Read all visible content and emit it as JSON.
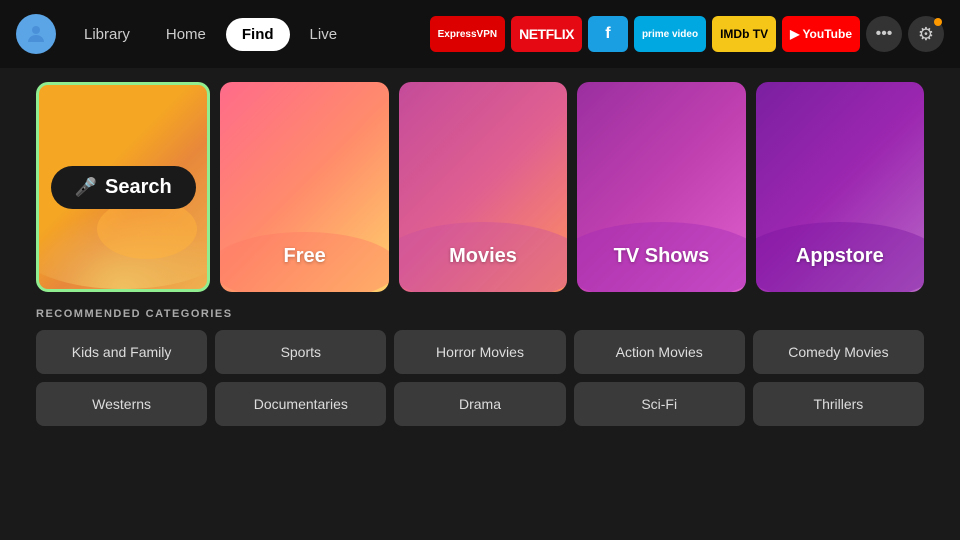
{
  "header": {
    "avatar_label": "👤",
    "nav": [
      {
        "label": "Library",
        "active": false
      },
      {
        "label": "Home",
        "active": false
      },
      {
        "label": "Find",
        "active": true
      },
      {
        "label": "Live",
        "active": false
      }
    ],
    "apps": [
      {
        "id": "expressvpn",
        "label": "ExpressVPN",
        "class": "express"
      },
      {
        "id": "netflix",
        "label": "NETFLIX",
        "class": "netflix"
      },
      {
        "id": "freevee",
        "label": "▶",
        "class": "freevee"
      },
      {
        "id": "prime",
        "label": "prime video",
        "class": "prime"
      },
      {
        "id": "imdb",
        "label": "IMDb TV",
        "class": "imdb"
      },
      {
        "id": "youtube",
        "label": "▶ YouTube",
        "class": "youtube"
      }
    ],
    "more_label": "•••",
    "settings_label": "⚙"
  },
  "cards": [
    {
      "id": "search",
      "label": "Search",
      "mic": "🎤",
      "class": "search-card"
    },
    {
      "id": "free",
      "label": "Free",
      "class": "free-card"
    },
    {
      "id": "movies",
      "label": "Movies",
      "class": "movies-card"
    },
    {
      "id": "tvshows",
      "label": "TV Shows",
      "class": "tvshows-card"
    },
    {
      "id": "appstore",
      "label": "Appstore",
      "class": "appstore-card"
    }
  ],
  "recommended": {
    "title": "RECOMMENDED CATEGORIES",
    "rows": [
      [
        {
          "id": "kids",
          "label": "Kids and Family"
        },
        {
          "id": "sports",
          "label": "Sports"
        },
        {
          "id": "horror",
          "label": "Horror Movies"
        },
        {
          "id": "action",
          "label": "Action Movies"
        },
        {
          "id": "comedy",
          "label": "Comedy Movies"
        }
      ],
      [
        {
          "id": "westerns",
          "label": "Westerns"
        },
        {
          "id": "documentaries",
          "label": "Documentaries"
        },
        {
          "id": "drama",
          "label": "Drama"
        },
        {
          "id": "scifi",
          "label": "Sci-Fi"
        },
        {
          "id": "thrillers",
          "label": "Thrillers"
        }
      ]
    ]
  }
}
